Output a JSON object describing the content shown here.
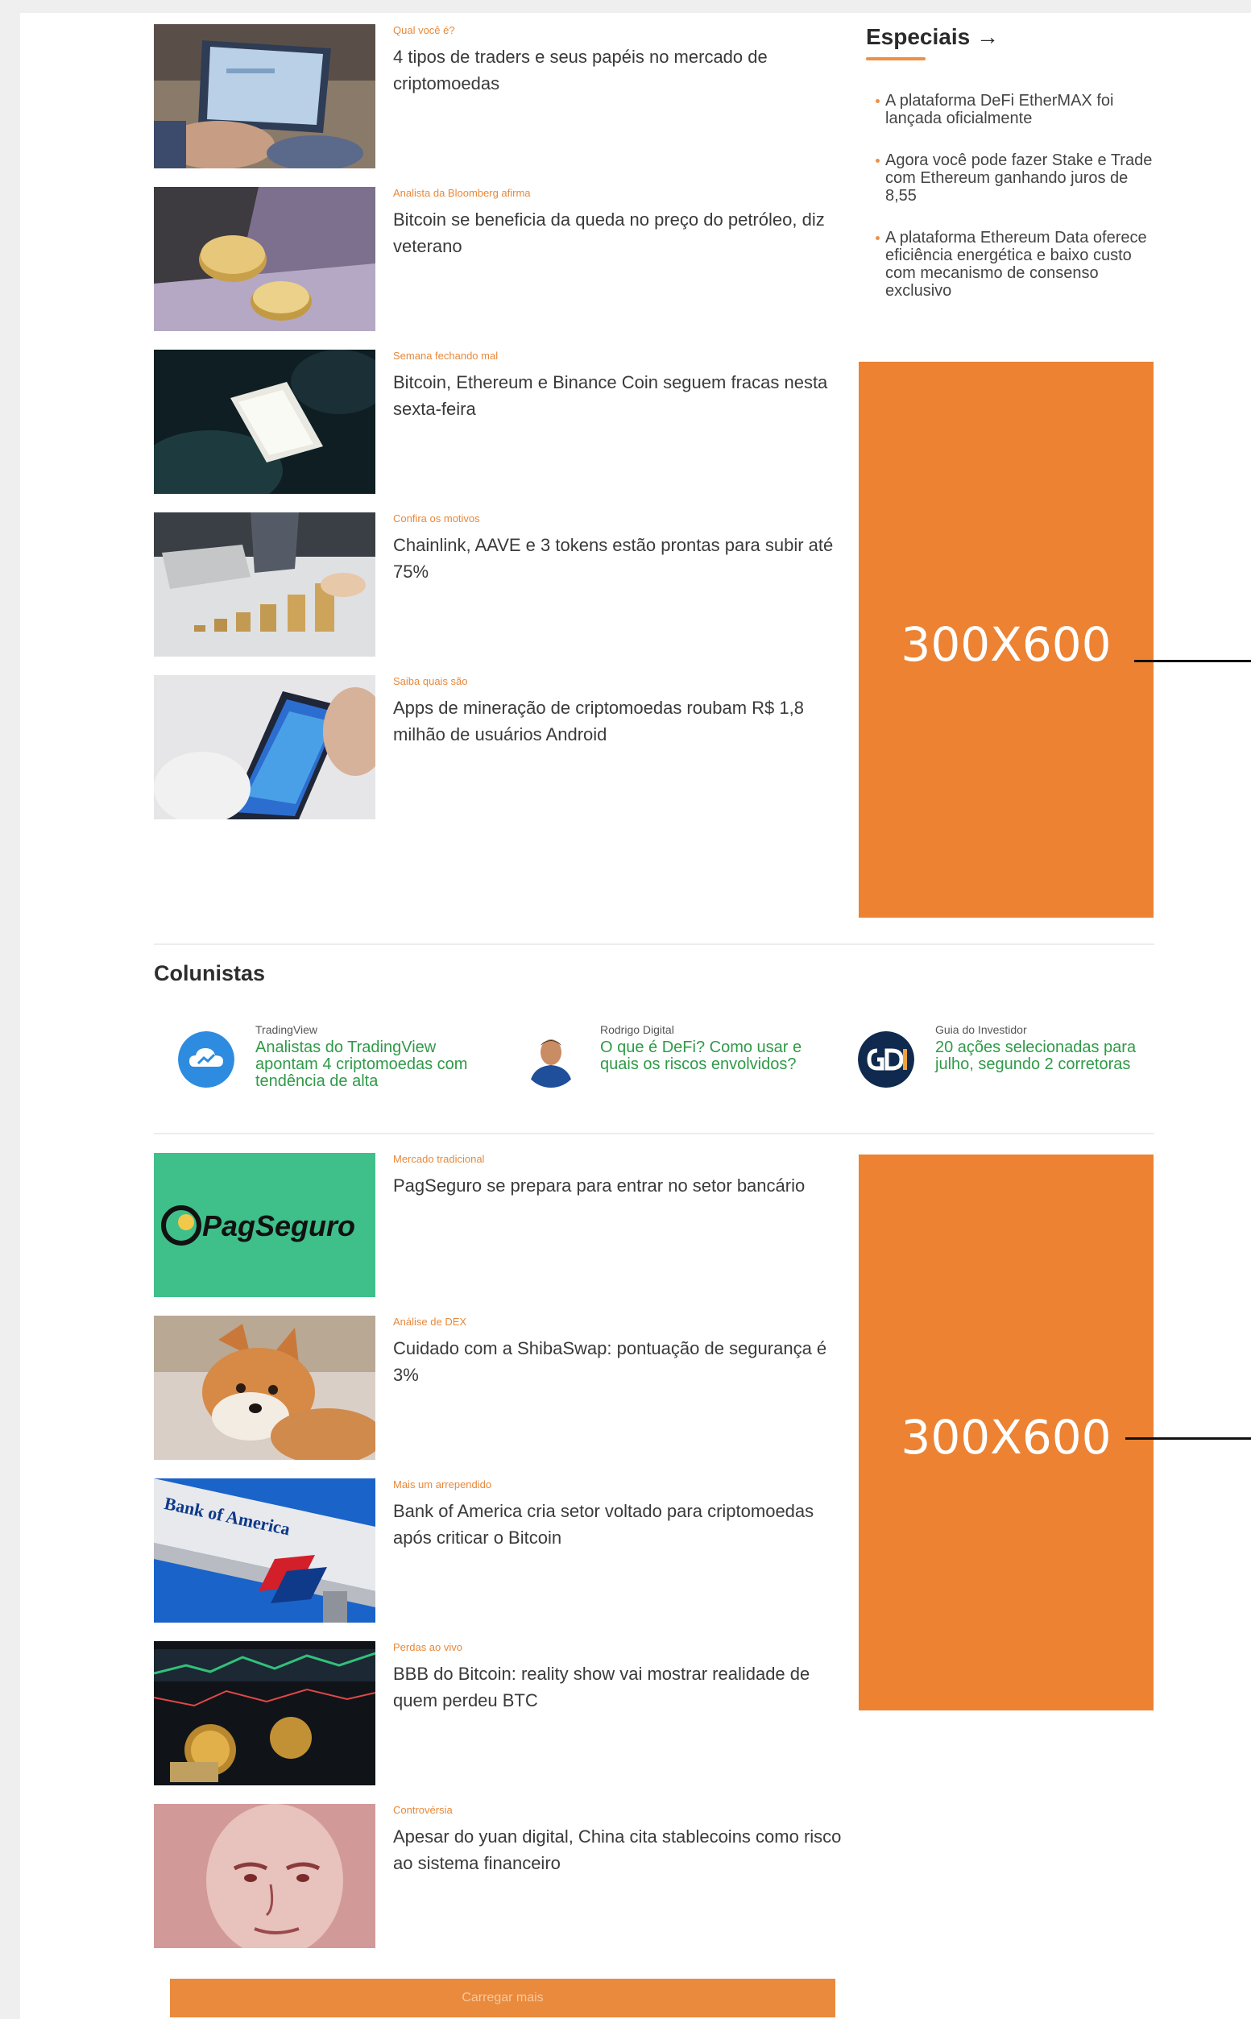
{
  "articles_top": [
    {
      "kicker": "Qual você é?",
      "title": "4 tipos de traders e seus papéis no mercado de criptomoedas",
      "image": "laptop-trader-photo"
    },
    {
      "kicker": "Analista da Bloomberg afirma",
      "title": "Bitcoin se beneficia da queda no preço do petróleo, diz veterano",
      "image": "bitcoin-coins-photo"
    },
    {
      "kicker": "Semana fechando mal",
      "title": "Bitcoin, Ethereum e Binance Coin seguem fracas nesta sexta-feira",
      "image": "phone-dark-photo"
    },
    {
      "kicker": "Confira os motivos",
      "title": "Chainlink, AAVE e 3 tokens estão prontas para subir até 75%",
      "image": "coin-stacks-photo"
    },
    {
      "kicker": "Saiba quais são",
      "title": "Apps de mineração de criptomoedas roubam R$ 1,8 milhão de usuários Android",
      "image": "android-phone-photo"
    }
  ],
  "specials": {
    "heading": "Especiais →",
    "items": [
      "A plataforma DeFi EtherMAX foi lançada oficialmente",
      "Agora você pode fazer Stake e Trade com Ethereum ganhando juros de 8,55",
      "A plataforma Ethereum Data oferece eficiência energética e baixo custo com mecanismo de consenso exclusivo"
    ]
  },
  "ads": [
    {
      "label": "300X600"
    },
    {
      "label": "300X600"
    }
  ],
  "columnists": {
    "heading": "Colunistas",
    "items": [
      {
        "name": "TradingView",
        "title": "Analistas do TradingView apontam 4 criptomoedas com tendência de alta",
        "avatar": "tradingview-cloud-icon"
      },
      {
        "name": "Rodrigo Digital",
        "title": "O que é DeFi? Como usar e quais os riscos envolvidos?",
        "avatar": "person-photo"
      },
      {
        "name": "Guia do Investidor",
        "title": "20 ações selecionadas para julho, segundo 2 corretoras",
        "avatar": "gdi-logo"
      }
    ]
  },
  "articles_bottom": [
    {
      "kicker": "Mercado tradicional",
      "title": "PagSeguro se prepara para entrar no setor bancário",
      "image": "pagseguro-logo",
      "logo_text": "PagSeguro"
    },
    {
      "kicker": "Análise de DEX",
      "title": "Cuidado com a ShibaSwap: pontuação de segurança é 3%",
      "image": "shiba-dog-photo"
    },
    {
      "kicker": "Mais um arrependido",
      "title": "Bank of America cria setor voltado para criptomoedas após criticar o Bitcoin",
      "image": "bank-of-america-sign",
      "sign_text": "Bank of America"
    },
    {
      "kicker": "Perdas ao vivo",
      "title": "BBB do Bitcoin: reality show vai mostrar realidade de quem perdeu BTC",
      "image": "bitcoin-trading-screen"
    },
    {
      "kicker": "Controvérsia",
      "title": "Apesar do yuan digital, China cita stablecoins como risco ao sistema financeiro",
      "image": "yuan-banknote"
    }
  ],
  "load_more": "Carregar mais",
  "colors": {
    "accent": "#ec8232",
    "link_green": "#2f9a48",
    "kicker_orange": "#e8883a"
  }
}
